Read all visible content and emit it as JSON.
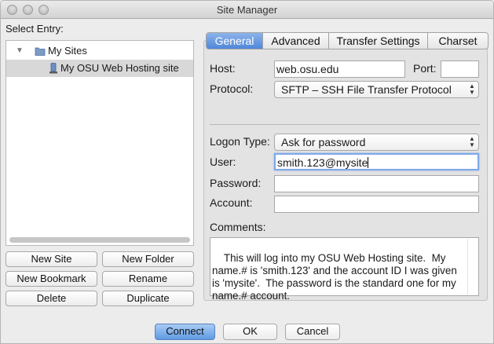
{
  "window": {
    "title": "Site Manager"
  },
  "left": {
    "select_entry_label": "Select Entry:",
    "tree": {
      "root": {
        "label": "My Sites",
        "icon": "folder-icon",
        "expanded": true
      },
      "site": {
        "label": "My OSU Web Hosting site",
        "icon": "server-icon",
        "selected": true
      }
    },
    "buttons": {
      "new_site": "New Site",
      "new_folder": "New Folder",
      "new_bookmark": "New Bookmark",
      "rename": "Rename",
      "delete": "Delete",
      "duplicate": "Duplicate"
    }
  },
  "tabs": [
    {
      "label": "General",
      "active": true
    },
    {
      "label": "Advanced",
      "active": false
    },
    {
      "label": "Transfer Settings",
      "active": false
    },
    {
      "label": "Charset",
      "active": false
    }
  ],
  "general": {
    "host_label": "Host:",
    "host_value": "web.osu.edu",
    "port_label": "Port:",
    "port_value": "",
    "protocol_label": "Protocol:",
    "protocol_value": "SFTP – SSH File Transfer Protocol",
    "logon_type_label": "Logon Type:",
    "logon_type_value": "Ask for password",
    "user_label": "User:",
    "user_value": "smith.123@mysite",
    "password_label": "Password:",
    "password_value": "",
    "account_label": "Account:",
    "account_value": "",
    "comments_label": "Comments:",
    "comments_value": "This will log into my OSU Web Hosting site.  My name.# is 'smith.123' and the account ID I was given is 'mysite'.  The password is the standard one for my name.# account."
  },
  "footer": {
    "connect": "Connect",
    "ok": "OK",
    "cancel": "Cancel"
  },
  "colors": {
    "accent": "#4f87d9",
    "focus_ring": "#7ea8e6",
    "selection_bg": "#d8d8d8"
  }
}
